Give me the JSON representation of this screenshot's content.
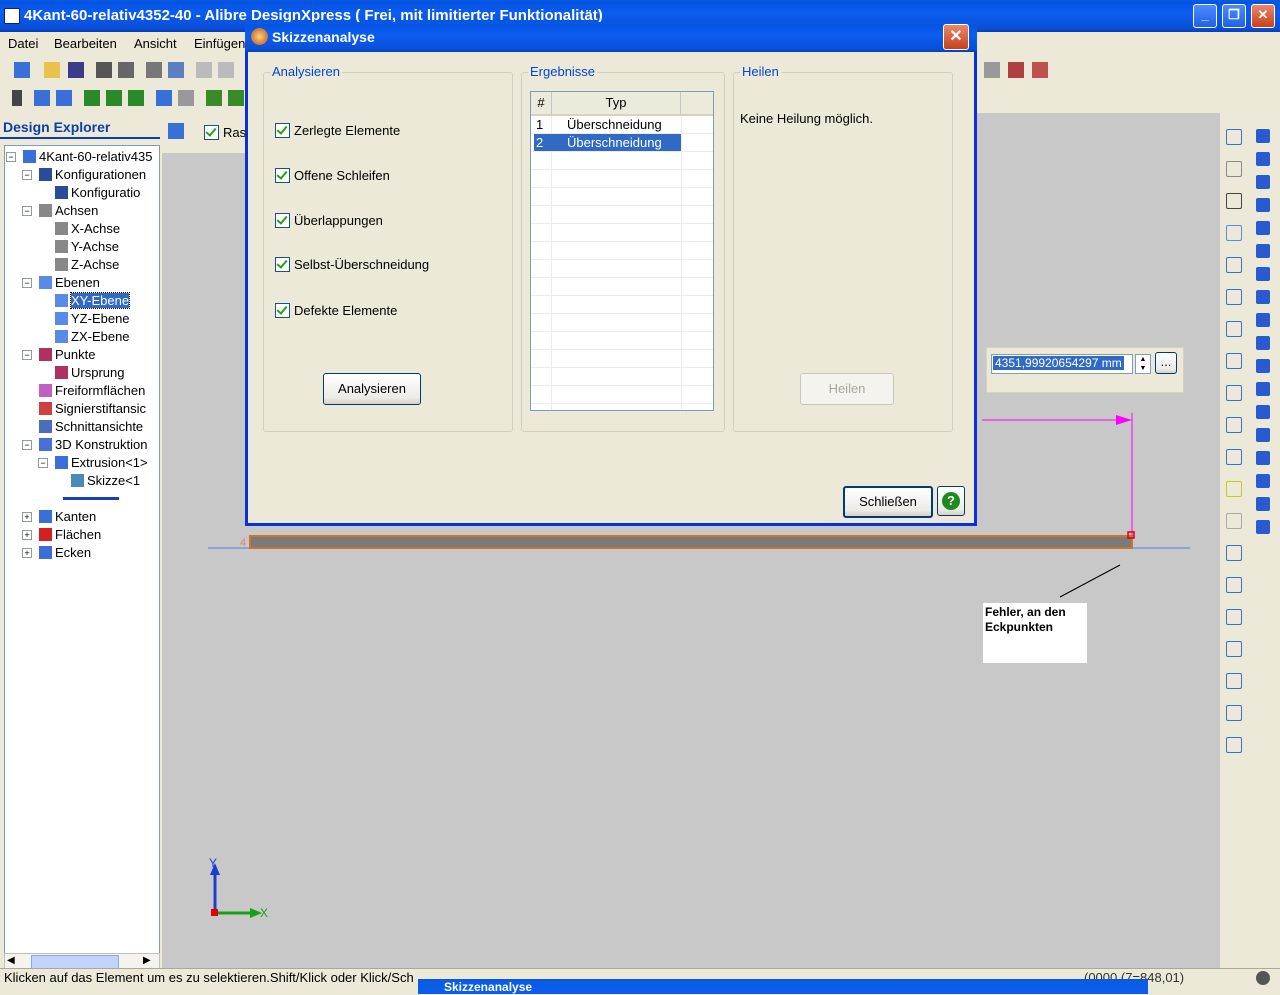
{
  "window": {
    "title": "4Kant-60-relativ4352-40 - Alibre DesignXpress ( Frei, mit limitierter Funktionalität)"
  },
  "menu": [
    "Datei",
    "Bearbeiten",
    "Ansicht",
    "Einfügen"
  ],
  "explorer": {
    "title": "Design Explorer",
    "tree": [
      {
        "label": "4Kant-60-relativ435",
        "level": 0,
        "exp": "−",
        "icon": "part-icon"
      },
      {
        "label": "Konfigurationen",
        "level": 1,
        "exp": "−",
        "icon": "table-icon"
      },
      {
        "label": "Konfiguratio",
        "level": 2,
        "exp": "",
        "icon": "table-icon"
      },
      {
        "label": "Achsen",
        "level": 1,
        "exp": "−",
        "icon": "axis-icon"
      },
      {
        "label": "X-Achse",
        "level": 2,
        "exp": "",
        "icon": "axis-icon"
      },
      {
        "label": "Y-Achse",
        "level": 2,
        "exp": "",
        "icon": "axis-icon"
      },
      {
        "label": "Z-Achse",
        "level": 2,
        "exp": "",
        "icon": "axis-icon"
      },
      {
        "label": "Ebenen",
        "level": 1,
        "exp": "−",
        "icon": "plane-icon"
      },
      {
        "label": "XY-Ebene",
        "level": 2,
        "exp": "",
        "icon": "plane-icon",
        "selected": true
      },
      {
        "label": "YZ-Ebene",
        "level": 2,
        "exp": "",
        "icon": "plane-icon"
      },
      {
        "label": "ZX-Ebene",
        "level": 2,
        "exp": "",
        "icon": "plane-icon"
      },
      {
        "label": "Punkte",
        "level": 1,
        "exp": "−",
        "icon": "point-icon"
      },
      {
        "label": "Ursprung",
        "level": 2,
        "exp": "",
        "icon": "point-icon"
      },
      {
        "label": "Freiformflächen",
        "level": 1,
        "exp": "",
        "icon": "surface-icon"
      },
      {
        "label": "Signierstiftansic",
        "level": 1,
        "exp": "",
        "icon": "pen-icon"
      },
      {
        "label": "Schnittansichte",
        "level": 1,
        "exp": "",
        "icon": "section-icon"
      },
      {
        "label": "3D Konstruktion",
        "level": 1,
        "exp": "−",
        "icon": "construction-icon"
      },
      {
        "label": "Extrusion<1>",
        "level": 2,
        "exp": "−",
        "icon": "extrude-icon"
      },
      {
        "label": "Skizze<1",
        "level": 3,
        "exp": "",
        "icon": "sketch-icon"
      },
      {
        "label": "",
        "level": 1,
        "exp": "",
        "icon": "rollback-marker-icon"
      },
      {
        "label": "Kanten",
        "level": 1,
        "exp": "+",
        "icon": "edge-icon"
      },
      {
        "label": "Flächen",
        "level": 1,
        "exp": "+",
        "icon": "face-icon"
      },
      {
        "label": "Ecken",
        "level": 1,
        "exp": "+",
        "icon": "vertex-icon"
      }
    ]
  },
  "sketch_tab": {
    "label": "Ras"
  },
  "dialog": {
    "title": "Skizzenanalyse",
    "analyze_group": {
      "title": "Analysieren",
      "options": [
        {
          "label": "Zerlegte Elemente",
          "checked": true
        },
        {
          "label": "Offene Schleifen",
          "checked": true
        },
        {
          "label": "Überlappungen",
          "checked": true
        },
        {
          "label": "Selbst-Überschneidung",
          "checked": true
        },
        {
          "label": "Defekte Elemente",
          "checked": true
        }
      ],
      "button": "Analysieren"
    },
    "results_group": {
      "title": "Ergebnisse",
      "columns": [
        "#",
        "Typ"
      ],
      "rows": [
        {
          "num": "1",
          "type": "Überschneidung",
          "selected": false
        },
        {
          "num": "2",
          "type": "Überschneidung",
          "selected": true
        }
      ]
    },
    "heal_group": {
      "title": "Heilen",
      "message": "Keine Heilung möglich.",
      "button": "Heilen"
    },
    "close_button": "Schließen",
    "help_button": "?"
  },
  "length_field": {
    "value": "4351,99920654297 mm",
    "browse": "..."
  },
  "annotation": {
    "text": "Fehler, an den Eckpunkten"
  },
  "status": {
    "text": "Klicken auf das Element um es zu selektieren.Shift/Klick oder Klick/Sch",
    "coords": "(0000,(7=848,01)"
  },
  "taskbar": {
    "dialog_title": "Skizzenanalyse"
  },
  "colors": {
    "titlebar": "#0054e3",
    "selection": "#316ac5",
    "sketch_line": "#ff00ff",
    "part_outline": "#c87533"
  }
}
